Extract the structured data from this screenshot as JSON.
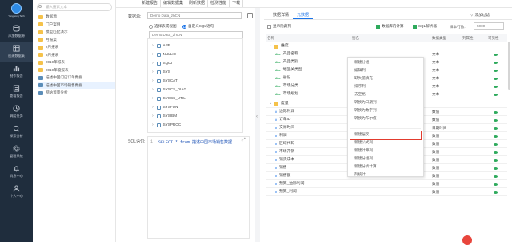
{
  "app": {
    "logo_text": "Yonghong Tech",
    "brand_color": "#1f2d3d"
  },
  "sidebar": {
    "items": [
      {
        "label": "添加数据源",
        "icon": "database-add-icon"
      },
      {
        "label": "创建数据集",
        "icon": "dataset-icon"
      },
      {
        "label": "制作报告",
        "icon": "chart-icon"
      },
      {
        "label": "查看报告",
        "icon": "report-icon"
      },
      {
        "label": "调度任务",
        "icon": "schedule-icon"
      },
      {
        "label": "探索分析",
        "icon": "explore-icon"
      },
      {
        "label": "管理系统",
        "icon": "gear-icon"
      },
      {
        "label": "消息中心",
        "icon": "bell-icon"
      },
      {
        "label": "个人中心",
        "icon": "user-icon"
      }
    ]
  },
  "tree": {
    "search_placeholder": "输入搜索文本",
    "items": [
      {
        "label": "数据源",
        "type": "folder"
      },
      {
        "label": "门户案例",
        "type": "folder"
      },
      {
        "label": "模型匹配演示",
        "type": "folder"
      },
      {
        "label": "月报案",
        "type": "folder"
      },
      {
        "label": "2月报表",
        "type": "folder"
      },
      {
        "label": "3月报表",
        "type": "folder"
      },
      {
        "label": "2019年报表",
        "type": "folder"
      },
      {
        "label": "2019年度报表",
        "type": "folder"
      },
      {
        "label": "描述中国门店订单数据",
        "type": "table"
      },
      {
        "label": "描述中国市场销售数据",
        "type": "table",
        "selected": true
      },
      {
        "label": "网站流量分析",
        "type": "table"
      }
    ]
  },
  "top_tabs": [
    "新建报告",
    "编辑数据集",
    "刷新数据",
    "检测性能",
    "下载"
  ],
  "config": {
    "datasource_label": "数据源:",
    "datasource_value": "Demo Data_zhCN",
    "radio_table": "选择表或视图",
    "radio_sql": "自定义SQL语句",
    "schema_select": "Demo Data_zhCN",
    "schemas": [
      "APP",
      "NULLID",
      "SQLJ",
      "SYS",
      "SYSCAT",
      "SYSCS_DIAG",
      "SYSCS_UTIL",
      "SYSFUN",
      "SYSIBM",
      "SYSPROC"
    ],
    "sql_label": "SQL语句:",
    "sql_line_no": "1",
    "sql_text": "SELECT * from 描述中国市场销售数据"
  },
  "right": {
    "tabs": [
      "数据详情",
      "元数据"
    ],
    "add_filter": "添加过滤",
    "show_hidden": "显示隐藏列",
    "check_cache": "数据库内计算",
    "check_sql": "SQL解析器",
    "sample_label": "样本行数:",
    "sample_value": "5000",
    "columns": [
      "名称",
      "别名",
      "数据类型",
      "列属性",
      "可见性"
    ],
    "group_dim": "维度",
    "group_measure": "度量",
    "dim_rows": [
      {
        "name": "产品名称",
        "dtype": "文本"
      },
      {
        "name": "产品类别",
        "dtype": "文本"
      },
      {
        "name": "地区关类型",
        "dtype": "文本"
      },
      {
        "name": "省份",
        "dtype": "文本"
      },
      {
        "name": "市场分类",
        "dtype": "文本"
      },
      {
        "name": "市场规划",
        "dtype": "文本"
      }
    ],
    "measure_rows": [
      {
        "name": "边际利润",
        "dtype": "数值"
      },
      {
        "name": "订单ID",
        "dtype": "数值"
      },
      {
        "name": "交易时间",
        "dtype": "日期时间"
      },
      {
        "name": "利润",
        "dtype": "数值"
      },
      {
        "name": "区域代码",
        "dtype": "数值"
      },
      {
        "name": "市场开销",
        "dtype": "数值"
      },
      {
        "name": "销货成本",
        "dtype": "数值"
      },
      {
        "name": "销售",
        "dtype": "数值"
      },
      {
        "name": "销售额",
        "dtype": "数值"
      },
      {
        "name": "预算_边际利润",
        "dtype": "数值"
      },
      {
        "name": "预算_利润",
        "dtype": "数值"
      }
    ]
  },
  "context_menu": {
    "items": [
      "新建分组",
      "编辑列",
      "缺失值填充",
      "排序列",
      "去空格",
      "转换为日期列",
      "转换为数字列",
      "转换为布尔值",
      "新建层次",
      "新建公式列",
      "新建计算列",
      "新建分组列",
      "新建分析计算",
      "列统计"
    ],
    "highlighted_index": 8,
    "highlight_color": "#e23b2e"
  }
}
